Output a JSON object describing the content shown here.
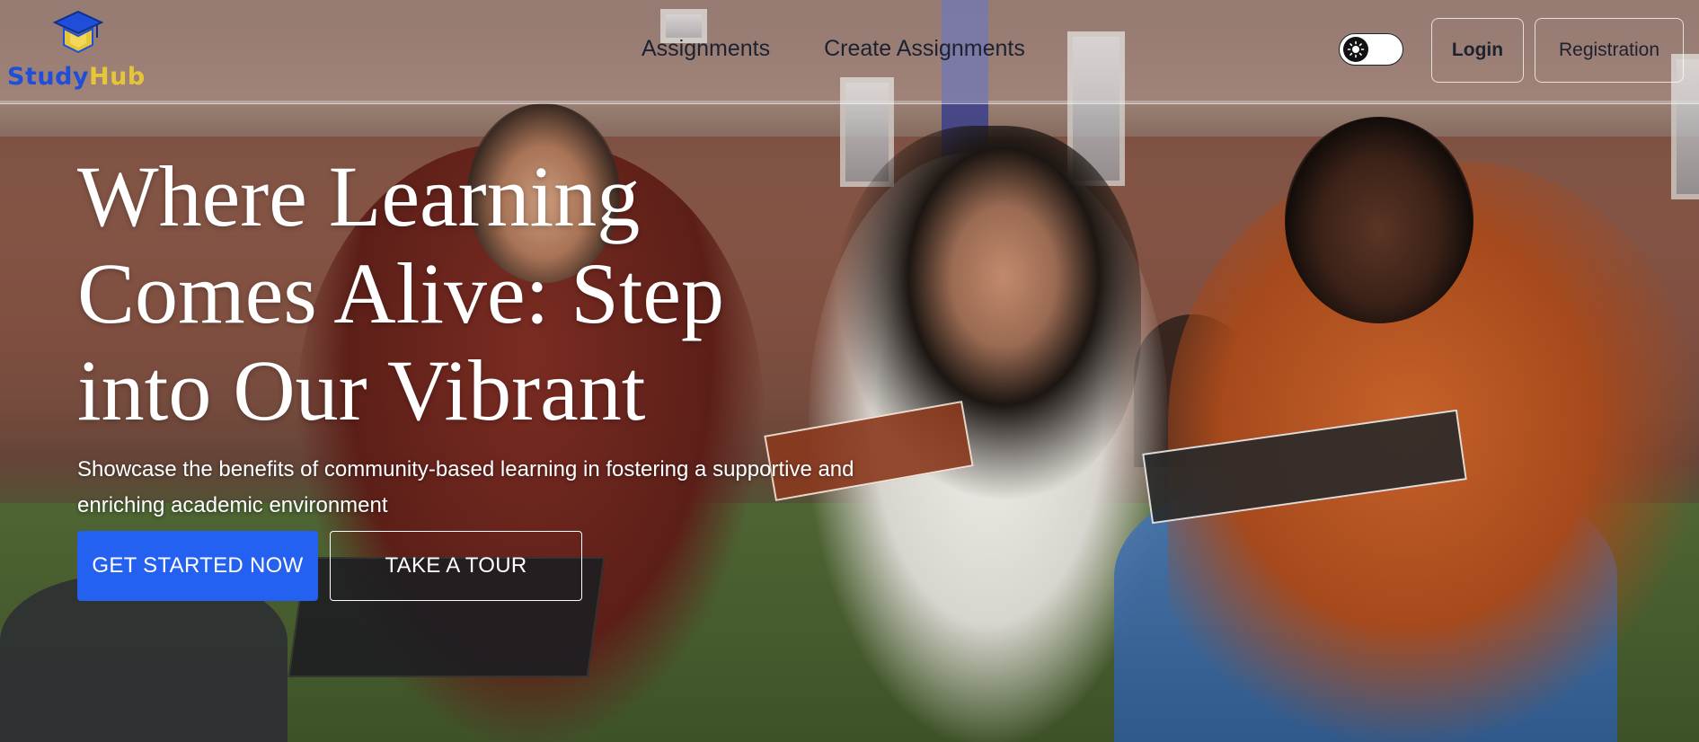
{
  "brand": {
    "name_part1": "Study",
    "name_part2": "Hub",
    "primary_color": "#1f4ed8",
    "accent_color": "#e5c53a",
    "logo_icon": "graduation-cap-icon"
  },
  "nav": {
    "links": [
      {
        "label": "Assignments"
      },
      {
        "label": "Create Assignments"
      }
    ],
    "theme_toggle": {
      "icon": "sun-icon",
      "state": "light"
    },
    "login_label": "Login",
    "register_label": "Registration"
  },
  "hero": {
    "headline": "Where Learning Comes Alive: Step into Our Vibrant",
    "subtitle": "Showcase the benefits of community-based learning in fostering a supportive and enriching academic environment",
    "primary_cta": "GET STARTED NOW",
    "secondary_cta": "TAKE A TOUR",
    "primary_cta_color": "#2561f0"
  }
}
